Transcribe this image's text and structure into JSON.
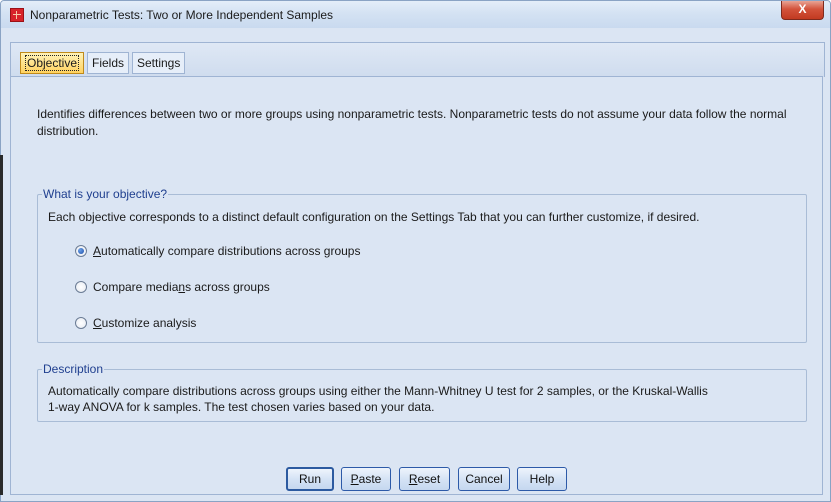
{
  "window": {
    "title": "Nonparametric Tests: Two or More Independent Samples",
    "close_label": "X"
  },
  "tabs": [
    {
      "label": "Objective",
      "active": true
    },
    {
      "label": "Fields",
      "active": false
    },
    {
      "label": "Settings",
      "active": false
    }
  ],
  "intro_text": "Identifies differences between two or more groups using nonparametric tests. Nonparametric tests do not assume your data follow the normal distribution.",
  "objective": {
    "legend": "What is your objective?",
    "help": "Each objective corresponds to a distinct default configuration on the Settings Tab that you can further customize, if desired.",
    "options": [
      {
        "pre": "",
        "mnemonic": "A",
        "post": "utomatically compare distributions across groups",
        "selected": true
      },
      {
        "pre": "Compare media",
        "mnemonic": "n",
        "post": "s across groups",
        "selected": false
      },
      {
        "pre": "",
        "mnemonic": "C",
        "post": "ustomize analysis",
        "selected": false
      }
    ]
  },
  "description": {
    "legend": "Description",
    "line1": "Automatically compare distributions across groups using either the Mann-Whitney U test for 2 samples, or the Kruskal-Wallis",
    "line2": "1-way ANOVA for k samples.  The test chosen varies based on your data."
  },
  "buttons": {
    "run": "Run",
    "paste": {
      "mnemonic": "P",
      "rest": "aste"
    },
    "reset": {
      "mnemonic": "R",
      "rest": "eset"
    },
    "cancel": "Cancel",
    "help": "Help"
  },
  "colors": {
    "panel_bg": "#dbe5f3",
    "group_legend": "#1f3f8f",
    "active_tab": "#ffd260",
    "button_border": "#2d5aa8"
  }
}
